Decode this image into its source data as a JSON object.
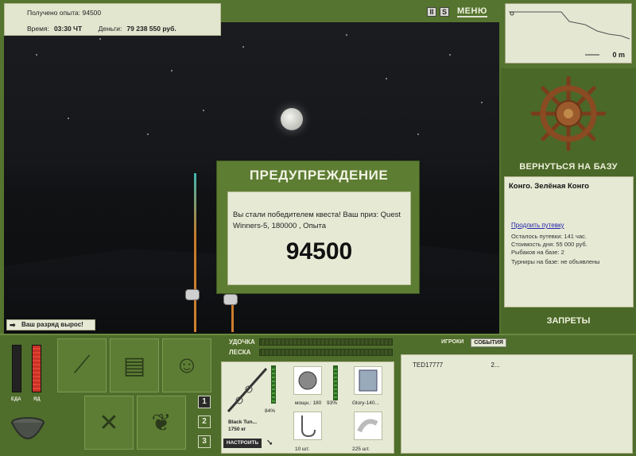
{
  "info": {
    "xp_label": "Получено опыта:",
    "xp_value": "94500",
    "time_label": "Время:",
    "time_value": "03:30 ЧТ",
    "money_label": "Деньги:",
    "money_value": "79 238 550 руб."
  },
  "top_icons": {
    "pause": "II",
    "sound": "S",
    "menu": "МЕНЮ"
  },
  "minimap": {
    "depth": "0 m"
  },
  "right": {
    "return_base": "ВЕРНУТЬСЯ НА БАЗУ",
    "base_title": "Конго. Зелёная Конго",
    "extend_link": "Продлить путевку",
    "lines": [
      "Осталось путевки: 141 час.",
      "Стоимость дня: 55 000 руб.",
      "Рыбаков на базе: 2",
      "Турниры на базе: не объявлены"
    ],
    "bans": "ЗАПРЕТЫ"
  },
  "rank_notice": "Ваш разряд вырос!",
  "dialog": {
    "title": "ПРЕДУПРЕЖДЕНИЕ",
    "message": "Вы стали победителем квеста! Ваш приз: Quest Winners-5, 180000 , Опыта",
    "value": "94500"
  },
  "meters": {
    "food": "ЕДА",
    "poison": "ЯД"
  },
  "num_buttons": [
    "1",
    "2",
    "3"
  ],
  "tackle": {
    "rod_label": "УДОЧКА",
    "line_label": "ЛЕСКА",
    "rod_name": "Black Tun...",
    "rod_weight": "1750 кг",
    "rod_percent": "84%",
    "reel_text": "мощн.: 180",
    "reel_percent": "93%",
    "lure_text": "Glory-140...",
    "hook_count": "10 шт.",
    "bait_count": "225 шт.",
    "setup_button": "НАСТРОИТЬ"
  },
  "players": {
    "tabs": [
      "ИГРОКИ",
      "СОБЫТИЯ"
    ],
    "active_tab": 1,
    "rows": [
      {
        "name": "TED17777",
        "value": "2..."
      }
    ]
  },
  "colors": {
    "panel": "#e6e9d4",
    "frame": "#55742f",
    "dialog": "#5d7d33",
    "night": "#15171a"
  }
}
